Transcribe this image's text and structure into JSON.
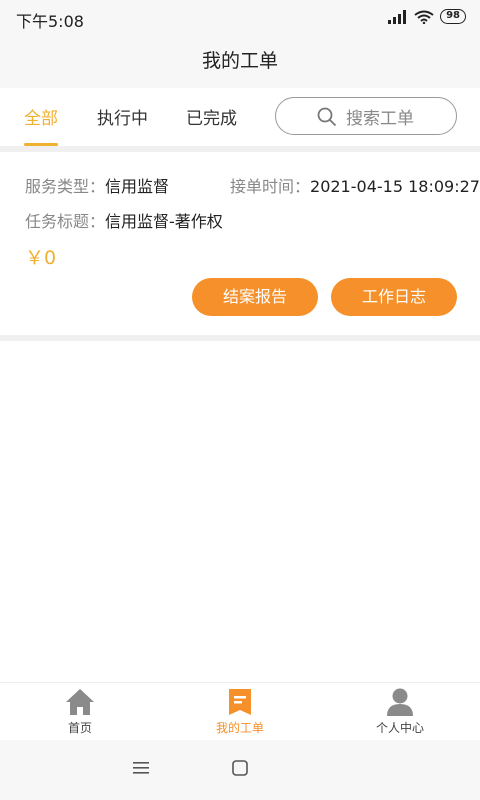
{
  "status": {
    "time": "下午5:08",
    "battery": "98"
  },
  "header": {
    "title": "我的工单"
  },
  "tabs": [
    {
      "label": "全部",
      "active": true
    },
    {
      "label": "执行中",
      "active": false
    },
    {
      "label": "已完成",
      "active": false
    }
  ],
  "search": {
    "placeholder": "搜索工单"
  },
  "order": {
    "service_type_label": "服务类型：",
    "service_type": "信用监督",
    "accept_time_label": "接单时间：",
    "accept_time": "2021-04-15 18:09:27",
    "task_title_label": "任务标题：",
    "task_title": "信用监督-著作权",
    "price": "￥0",
    "report_button": "结案报告",
    "log_button": "工作日志"
  },
  "bottom_nav": [
    {
      "label": "首页",
      "icon": "home-icon",
      "active": false
    },
    {
      "label": "我的工单",
      "icon": "work-order-icon",
      "active": true
    },
    {
      "label": "个人中心",
      "icon": "person-icon",
      "active": false
    }
  ],
  "colors": {
    "accent": "#f0b030",
    "button": "#f5902a"
  }
}
